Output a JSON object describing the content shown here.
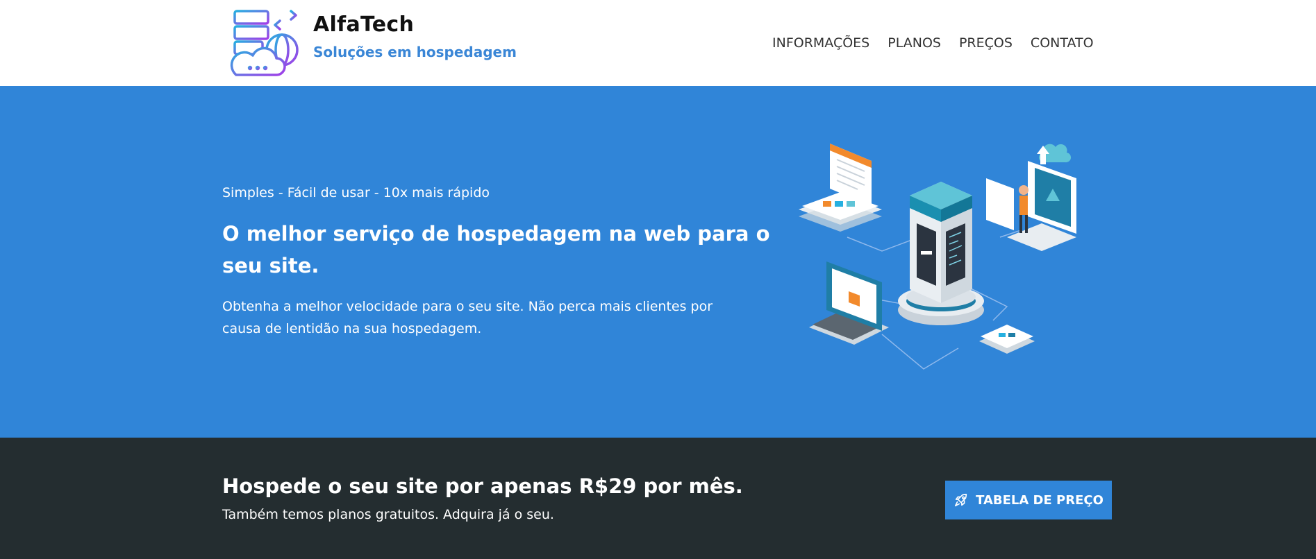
{
  "brand": {
    "name": "AlfaTech",
    "tagline": "Soluções em hospedagem",
    "logo_icon": "server-cloud-globe-icon"
  },
  "nav": {
    "items": [
      {
        "label": "INFORMAÇÕES"
      },
      {
        "label": "PLANOS"
      },
      {
        "label": "PREÇOS"
      },
      {
        "label": "CONTATO"
      }
    ]
  },
  "hero": {
    "kicker": "Simples - Fácil de usar - 10x mais rápido",
    "title": "O melhor serviço de hospedagem na web para o seu site.",
    "text": "Obtenha a melhor velocidade para o seu site. Não perca mais clientes por causa de lentidão na sua hospedagem.",
    "illustration_icon": "isometric-hosting-illustration"
  },
  "cta": {
    "title": "Hospede o seu site por apenas R$29 por mês.",
    "subtitle": "Também temos planos gratuitos. Adquira já o seu.",
    "button_label": "TABELA DE PREÇO",
    "button_icon": "rocket-icon"
  },
  "colors": {
    "hero_bg": "#3085d8",
    "cta_bg": "#242d30",
    "accent": "#3a86d6"
  }
}
